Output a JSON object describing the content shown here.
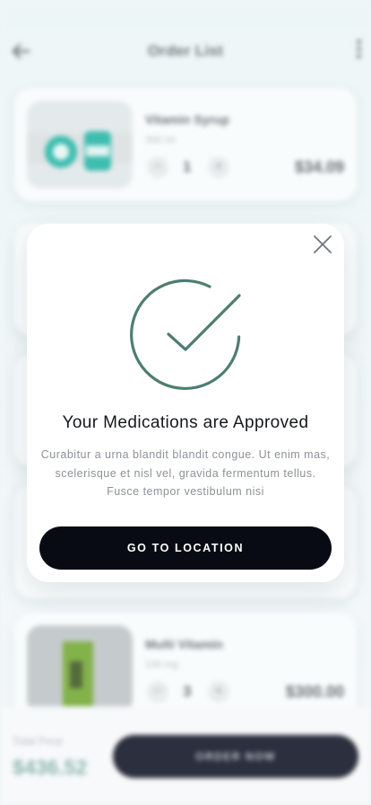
{
  "header": {
    "title": "Order List"
  },
  "cards": [
    {
      "name": "Vitamin Syrup",
      "size": "300 ml",
      "qty": "1",
      "price": "$34.09"
    },
    {
      "name": "Multi Vitamin",
      "size": "100 mg",
      "qty": "3",
      "price": "$300.00"
    }
  ],
  "qty_controls": {
    "minus": "−",
    "plus": "+"
  },
  "footer": {
    "total_label": "Total Price",
    "total_value": "$436.52",
    "order_button": "ORDER NOW"
  },
  "modal": {
    "title": "Your Medications are Approved",
    "body": "Curabitur a urna blandit blandit congue. Ut enim mas, scelerisque et nisl vel, gravida fermentum tellus. Fusce tempor vestibulum nisi",
    "button": "GO TO LOCATION"
  },
  "colors": {
    "accent": "#4e7d72",
    "button_dark": "#080b14",
    "price_green": "#8db8b0"
  }
}
